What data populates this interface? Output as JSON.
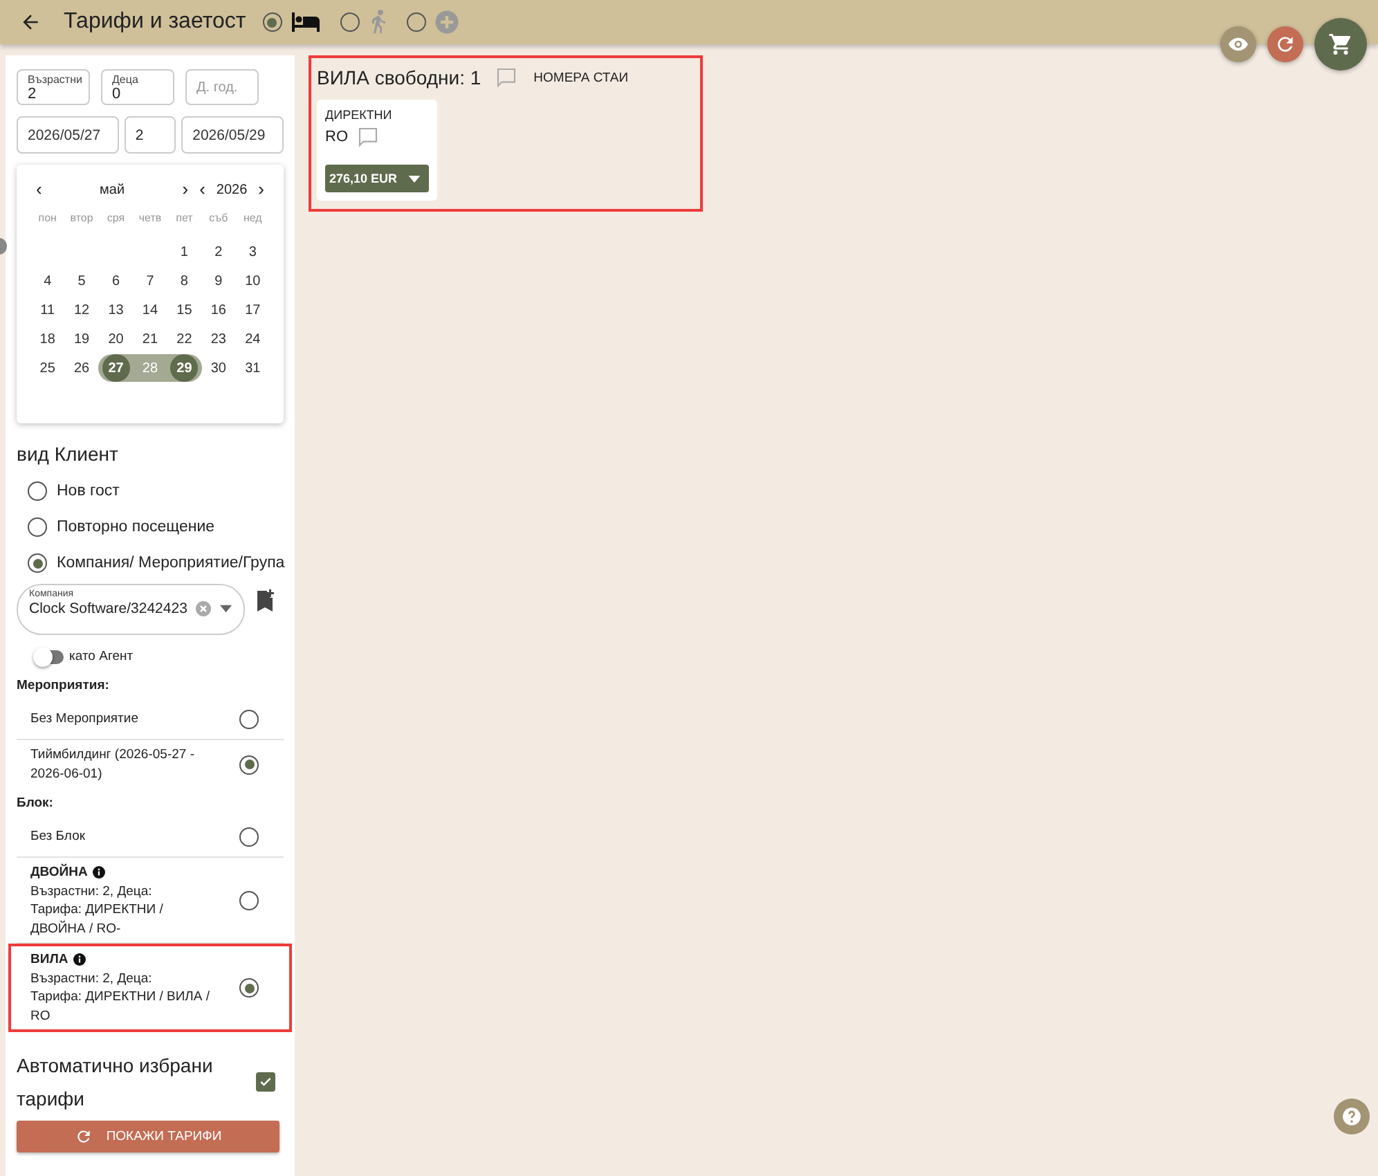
{
  "header": {
    "title": "Тарифи и заетост",
    "modes": [
      {
        "kind": "bed",
        "selected": true
      },
      {
        "kind": "walk",
        "selected": false
      },
      {
        "kind": "plus",
        "selected": false
      }
    ]
  },
  "sidebar": {
    "guests": [
      {
        "label": "Възрастни",
        "value": "2"
      },
      {
        "label": "Деца",
        "value": "0"
      },
      {
        "placeholder": "Д. год."
      }
    ],
    "dates": {
      "from": "2026/05/27",
      "nights": "2",
      "to": "2026/05/29"
    },
    "calendar": {
      "prev_month": "‹",
      "month": "май",
      "next_month": "›",
      "prev_year": "‹",
      "year": "2026",
      "next_year": "›",
      "weekdays": [
        "пон",
        "втор",
        "сря",
        "четв",
        "пет",
        "съб",
        "нед"
      ],
      "weeks": [
        [
          {
            "day": "1",
            "selected": false,
            "in_range": false
          },
          {
            "day": "2",
            "selected": false,
            "in_range": false
          },
          {
            "day": "3",
            "selected": false,
            "in_range": false
          }
        ],
        [
          {
            "day": "4",
            "selected": false,
            "in_range": false
          },
          {
            "day": "5",
            "selected": false,
            "in_range": false
          },
          {
            "day": "6",
            "selected": false,
            "in_range": false
          },
          {
            "day": "7",
            "selected": false,
            "in_range": false
          },
          {
            "day": "8",
            "selected": false,
            "in_range": false
          },
          {
            "day": "9",
            "selected": false,
            "in_range": false
          },
          {
            "day": "10",
            "selected": false,
            "in_range": false
          }
        ],
        [
          {
            "day": "11",
            "selected": false,
            "in_range": false
          },
          {
            "day": "12",
            "selected": false,
            "in_range": false
          },
          {
            "day": "13",
            "selected": false,
            "in_range": false
          },
          {
            "day": "14",
            "selected": false,
            "in_range": false
          },
          {
            "day": "15",
            "selected": false,
            "in_range": false
          },
          {
            "day": "16",
            "selected": false,
            "in_range": false
          },
          {
            "day": "17",
            "selected": false,
            "in_range": false
          }
        ],
        [
          {
            "day": "18",
            "selected": false,
            "in_range": false
          },
          {
            "day": "19",
            "selected": false,
            "in_range": false
          },
          {
            "day": "20",
            "selected": false,
            "in_range": false
          },
          {
            "day": "21",
            "selected": false,
            "in_range": false
          },
          {
            "day": "22",
            "selected": false,
            "in_range": false
          },
          {
            "day": "23",
            "selected": false,
            "in_range": false
          },
          {
            "day": "24",
            "selected": false,
            "in_range": false
          }
        ],
        [
          {
            "day": "25",
            "selected": false,
            "in_range": false
          },
          {
            "day": "26",
            "selected": false,
            "in_range": false
          },
          {
            "day": "27",
            "selected": true,
            "in_range": true
          },
          {
            "day": "28",
            "selected": false,
            "in_range": true
          },
          {
            "day": "29",
            "selected": true,
            "in_range": true
          },
          {
            "day": "30",
            "selected": false,
            "in_range": false
          },
          {
            "day": "31",
            "selected": false,
            "in_range": false
          }
        ]
      ]
    },
    "client_type": {
      "title": "вид Клиент",
      "options": [
        {
          "label": "Нов гост",
          "selected": false
        },
        {
          "label": "Повторно посещение",
          "selected": false
        },
        {
          "label": "Компания/ Мероприятие/Група",
          "selected": true
        }
      ]
    },
    "company": {
      "label": "Компания",
      "value": "Clock Software/3242423"
    },
    "agent": {
      "label": "като Агент",
      "on": false
    },
    "events": {
      "title": "Мероприятия:",
      "options": [
        {
          "label": "Без Мероприятие",
          "selected": false
        },
        {
          "label": "Тиймбилдинг (2026-05-27 - 2026-06-01)",
          "selected": true
        }
      ]
    },
    "blocks": {
      "title": "Блок:",
      "options": [
        {
          "kind": "plain",
          "label": "Без Блок",
          "selected": false,
          "highlighted": false
        },
        {
          "kind": "detailed",
          "label": "ДВОЙНА",
          "lines": [
            "Възрастни: 2, Деца:",
            "Тарифа: ДИРЕКТНИ / ДВОЙНА / RO-"
          ],
          "selected": false,
          "highlighted": false
        },
        {
          "kind": "detailed",
          "label": "ВИЛА",
          "lines": [
            "Възрастни: 2, Деца:",
            "Тарифа: ДИРЕКТНИ / ВИЛА / RO"
          ],
          "selected": true,
          "highlighted": true
        }
      ]
    },
    "auto_rates": {
      "label": "Автоматично избрани тарифи",
      "checked": true
    },
    "show_button": "ПОКАЖИ ТАРИФИ"
  },
  "rooms": [
    {
      "title": "ВИЛА свободни: 1",
      "numbers_button": "НОМЕРА СТАИ",
      "highlighted": true,
      "rates": [
        {
          "name": "ДИРЕКТНИ",
          "plan": "RO",
          "price": "276,10 EUR"
        }
      ]
    }
  ]
}
